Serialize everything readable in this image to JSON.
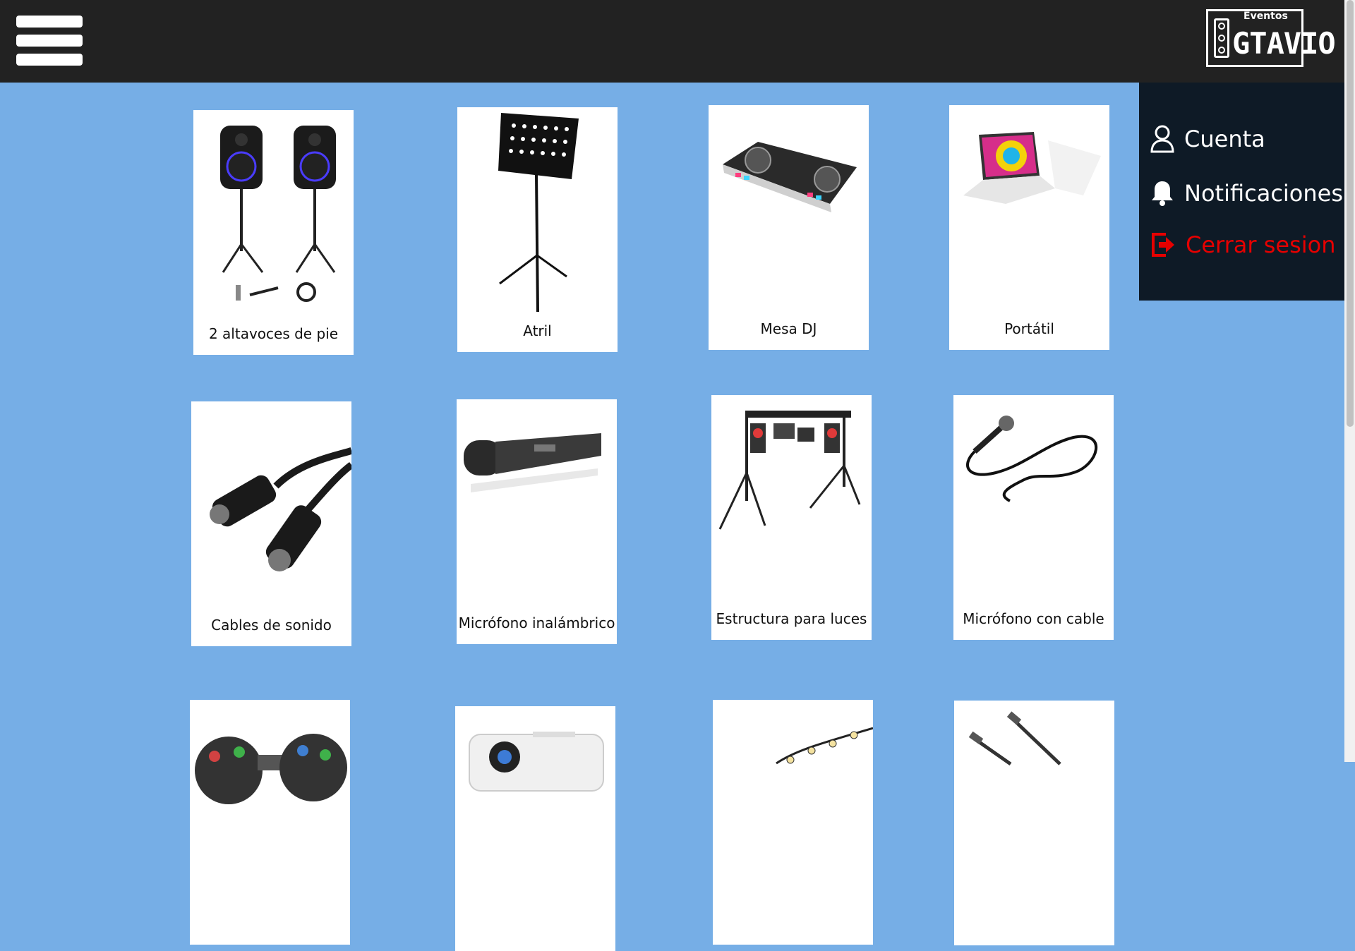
{
  "header": {
    "menu_icon": "hamburger-menu-icon",
    "logo_small_text": "Eventos",
    "logo_word": "GTAVIO",
    "background": "#222222"
  },
  "account_menu": {
    "items": [
      {
        "label": "Cuenta",
        "icon": "user-icon"
      },
      {
        "label": "Notificaciones",
        "icon": "bell-icon"
      },
      {
        "label": "Cerrar sesion",
        "icon": "logout-icon",
        "color": "#e60000"
      }
    ]
  },
  "products": [
    {
      "name": "2 altavoces de pie",
      "icon": "speakers-image"
    },
    {
      "name": "Atril",
      "icon": "music-stand-image"
    },
    {
      "name": "Mesa DJ",
      "icon": "dj-controller-image"
    },
    {
      "name": "Portátil",
      "icon": "laptop-image"
    },
    {
      "name": "Cables de sonido",
      "icon": "xlr-cable-image"
    },
    {
      "name": "Micrófono inalámbrico",
      "icon": "wireless-mic-image"
    },
    {
      "name": "Estructura para luces",
      "icon": "light-truss-image"
    },
    {
      "name": "Micrófono con cable",
      "icon": "wired-mic-image"
    },
    {
      "name": "",
      "icon": "disco-lights-image"
    },
    {
      "name": "",
      "icon": "projector-image"
    },
    {
      "name": "",
      "icon": "string-lights-image"
    },
    {
      "name": "",
      "icon": "mic-stands-image"
    }
  ],
  "colors": {
    "page_background": "#76aee6",
    "menu_background": "#0e1a26",
    "logout": "#e60000"
  }
}
